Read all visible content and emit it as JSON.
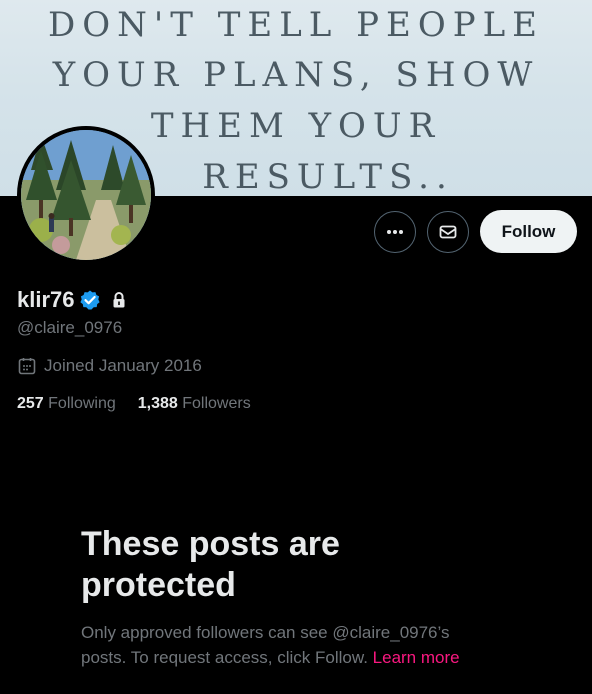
{
  "banner": {
    "lines": [
      "DON'T TELL PEOPLE",
      "YOUR PLANS, SHOW",
      "THEM YOUR",
      "RESULTS.."
    ]
  },
  "profile": {
    "display_name": "klir76",
    "handle": "@claire_0976",
    "joined": "Joined January 2016",
    "following_count": "257",
    "following_label": "Following",
    "followers_count": "1,388",
    "followers_label": "Followers"
  },
  "actions": {
    "more_icon": "more-dots-icon",
    "message_icon": "envelope-icon",
    "follow_label": "Follow"
  },
  "protected": {
    "title_line1": "These posts are",
    "title_line2": "protected",
    "body_line1": "Only approved followers can see @claire_0976’s",
    "body_line2": "posts. To request access, click Follow.",
    "learn_more": "Learn more"
  },
  "colors": {
    "background": "#000000",
    "verified": "#1d9bf0",
    "link": "#f91880",
    "muted": "#71767b",
    "text": "#e7e9ea"
  }
}
